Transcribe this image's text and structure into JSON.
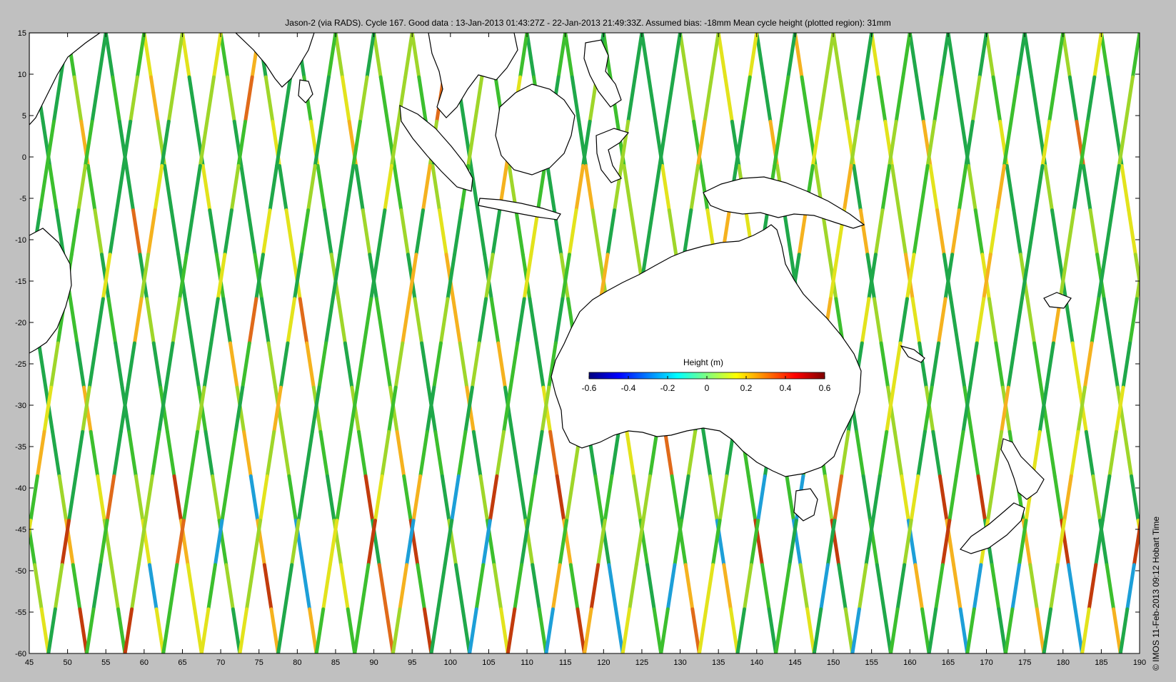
{
  "title": "Jason-2 (via RADS). Cycle 167. Good data : 13-Jan-2013 01:43:27Z - 22-Jan-2013 21:49:33Z. Assumed bias: -18mm  Mean cycle height (plotted region): 31mm",
  "credit": "© IMOS 11-Feb-2013 09:12 Hobart Time",
  "map": {
    "lon_range": [
      45,
      190
    ],
    "lat_range": [
      -60,
      15
    ],
    "x_ticks": [
      "45",
      "50",
      "55",
      "60",
      "65",
      "70",
      "75",
      "80",
      "85",
      "90",
      "95",
      "100",
      "105",
      "110",
      "115",
      "120",
      "125",
      "130",
      "135",
      "140",
      "145",
      "150",
      "155",
      "160",
      "165",
      "170",
      "175",
      "180",
      "185",
      "190"
    ],
    "y_ticks": [
      "15",
      "10",
      "5",
      "0",
      "-5",
      "-10",
      "-15",
      "-20",
      "-25",
      "-30",
      "-35",
      "-40",
      "-45",
      "-50",
      "-55",
      "-60"
    ],
    "background_color": "#ffffff",
    "coastline_color": "#000000",
    "track_colors": [
      "#1fa84a",
      "#3cbf2e",
      "#9fd62a",
      "#e3e31c",
      "#f5b21f",
      "#e06a1a",
      "#c23b0c",
      "#1d9fd8"
    ]
  },
  "colorbar": {
    "label": "Height (m)",
    "ticks": [
      "-0.6",
      "-0.4",
      "-0.2",
      "0",
      "0.2",
      "0.4",
      "0.6"
    ],
    "colors": [
      "#00007f",
      "#0000ff",
      "#007fff",
      "#00ffff",
      "#7fff7f",
      "#ffff00",
      "#ff7f00",
      "#ff0000",
      "#7f0000"
    ]
  }
}
